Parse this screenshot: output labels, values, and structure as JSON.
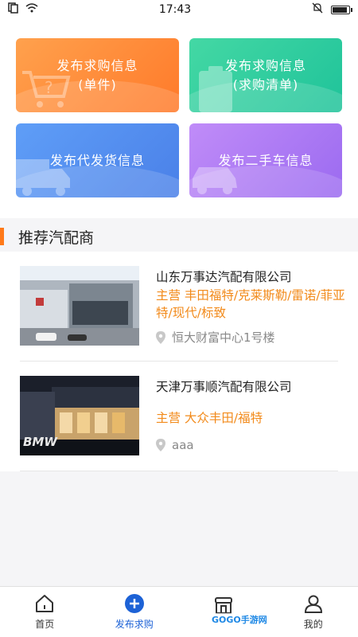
{
  "status_bar": {
    "time": "17:43"
  },
  "cards": [
    {
      "line1": "发布求购信息",
      "line2": "(单件)"
    },
    {
      "line1": "发布求购信息",
      "line2": "(求购清单)"
    },
    {
      "line1": "发布代发货信息",
      "line2": ""
    },
    {
      "line1": "发布二手车信息",
      "line2": ""
    }
  ],
  "section": {
    "title": "推荐汽配商"
  },
  "dealers": [
    {
      "name": "山东万事达汽配有限公司",
      "main_business": "主营 丰田福特/克莱斯勒/雷诺/菲亚特/现代/标致",
      "address": "恒大财富中心1号楼"
    },
    {
      "name": "天津万事顺汽配有限公司",
      "main_business": "主营 大众丰田/福特",
      "address": "aaa"
    }
  ],
  "tabbar": [
    {
      "label": "首页",
      "icon": "home-icon"
    },
    {
      "label": "发布求购",
      "icon": "plus-circle-icon"
    },
    {
      "label": "GOGO手游网",
      "icon": "store-icon"
    },
    {
      "label": "我的",
      "icon": "user-icon"
    }
  ],
  "watermark": {
    "text": "GOGO手游网"
  },
  "colors": {
    "accent": "#ff7a1a",
    "tab_active": "#1d62d6",
    "orange_text": "#f28a1a"
  }
}
